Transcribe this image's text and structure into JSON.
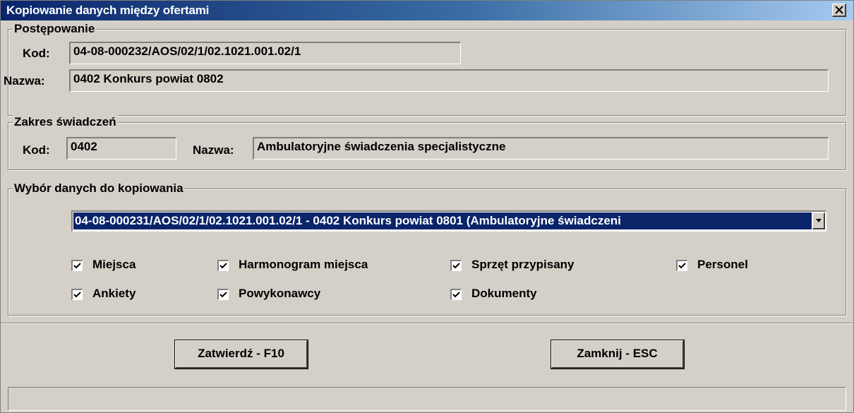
{
  "window": {
    "title": "Kopiowanie danych między ofertami",
    "close_label": "✕"
  },
  "postepowanie": {
    "legend": "Postępowanie",
    "kod_label": "Kod:",
    "kod_value": "04-08-000232/AOS/02/1/02.1021.001.02/1",
    "nazwa_label": "Nazwa:",
    "nazwa_value": "0402 Konkurs powiat 0802"
  },
  "zakres": {
    "legend": "Zakres świadczeń",
    "kod_label": "Kod:",
    "kod_value": "0402",
    "nazwa_label": "Nazwa:",
    "nazwa_value": "Ambulatoryjne świadczenia specjalistyczne"
  },
  "wybor": {
    "legend": "Wybór danych do kopiowania",
    "selected_offer": "04-08-000231/AOS/02/1/02.1021.001.02/1 - 0402 Konkurs powiat 0801 (Ambulatoryjne świadczeni",
    "checkboxes": [
      {
        "label": "Miejsca",
        "checked": true
      },
      {
        "label": "Harmonogram miejsca",
        "checked": true
      },
      {
        "label": "Sprzęt przypisany",
        "checked": true
      },
      {
        "label": "Personel",
        "checked": true
      },
      {
        "label": "Ankiety",
        "checked": true
      },
      {
        "label": "Powykonawcy",
        "checked": true
      },
      {
        "label": "Dokumenty",
        "checked": true
      }
    ]
  },
  "buttons": {
    "confirm": "Zatwierdź - F10",
    "close": "Zamknij - ESC"
  },
  "status": {
    "text": ""
  },
  "colors": {
    "dialog_bg": "#d4d0c8",
    "title_start": "#0a246a",
    "title_end": "#a6caf0",
    "selection": "#0a246a"
  }
}
